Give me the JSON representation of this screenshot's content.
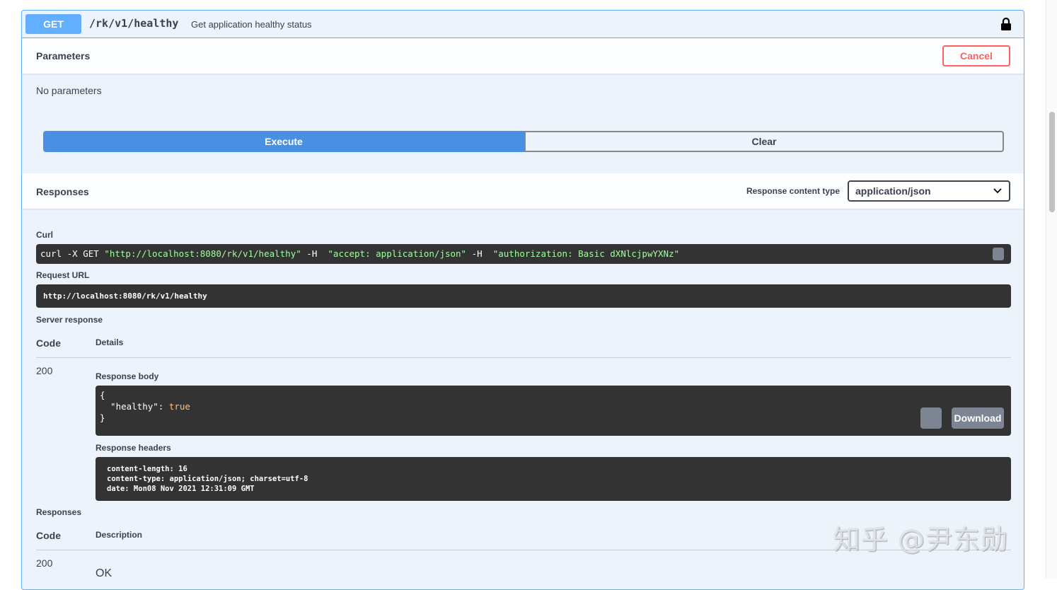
{
  "operation": {
    "method": "GET",
    "path": "/rk/v1/healthy",
    "summary": "Get application healthy status",
    "lock_icon": "lock-icon"
  },
  "parameters": {
    "title": "Parameters",
    "cancel_label": "Cancel",
    "empty_text": "No parameters",
    "execute_label": "Execute",
    "clear_label": "Clear"
  },
  "responses_header": {
    "title": "Responses",
    "content_type_label": "Response content type",
    "content_type_value": "application/json"
  },
  "curl": {
    "label": "Curl",
    "cmd_prefix": "curl -X GET ",
    "url": "\"http://localhost:8080/rk/v1/healthy\"",
    "h1_flag": " -H  ",
    "h1": "\"accept: application/json\"",
    "h2_flag": " -H  ",
    "h2": "\"authorization: Basic dXNlcjpwYXNz\""
  },
  "request_url": {
    "label": "Request URL",
    "value": "http://localhost:8080/rk/v1/healthy"
  },
  "server_response": {
    "label": "Server response",
    "code_header": "Code",
    "details_header": "Details",
    "code": "200",
    "body_label": "Response body",
    "body_open": "{",
    "body_key": "  \"healthy\": ",
    "body_value": "true",
    "body_close": "}",
    "download_label": "Download",
    "headers_label": "Response headers",
    "headers_text": "content-length: 16\ncontent-type: application/json; charset=utf-8\ndate: Mon08 Nov 2021 12:31:09 GMT"
  },
  "responses": {
    "label": "Responses",
    "code_header": "Code",
    "description_header": "Description",
    "code": "200",
    "description": "OK"
  },
  "watermark": "知乎 @尹东勋",
  "colors": {
    "get_blue": "#61affe",
    "execute_blue": "#4990e2",
    "cancel_red": "#ff6060",
    "code_bg": "#333333",
    "string_green": "#a2fca2",
    "bool_orange": "#fcc28c"
  }
}
